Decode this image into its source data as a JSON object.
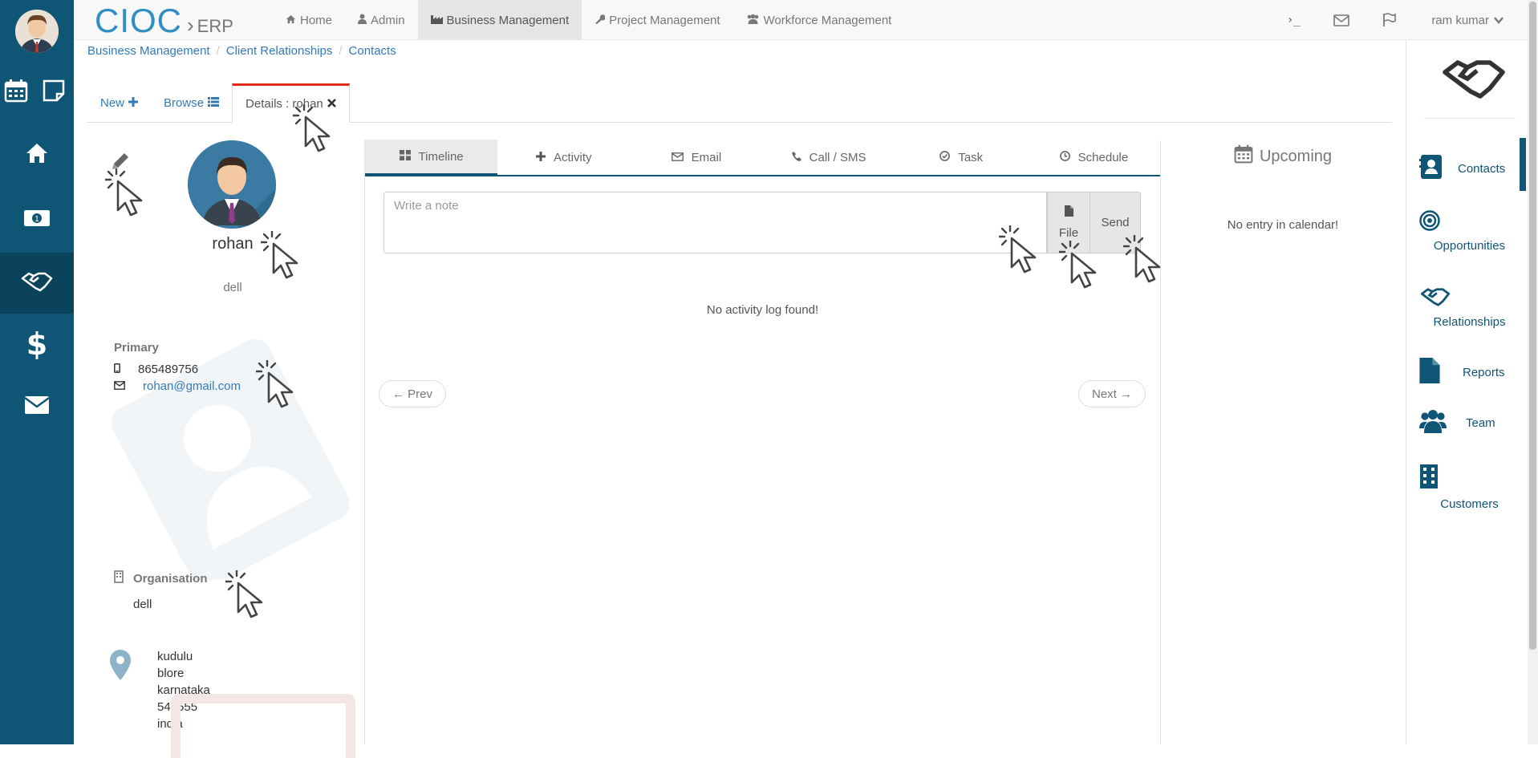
{
  "brand": {
    "logo": "CIOC",
    "separator": "›",
    "product": "ERP"
  },
  "top_menu": [
    {
      "label": "Home",
      "icon": "home-icon"
    },
    {
      "label": "Admin",
      "icon": "user-icon"
    },
    {
      "label": "Business Management",
      "icon": "industry-icon",
      "active": true
    },
    {
      "label": "Project Management",
      "icon": "wrench-icon"
    },
    {
      "label": "Workforce Management",
      "icon": "users-icon"
    }
  ],
  "top_right": {
    "terminal": "›_",
    "user_name": "ram kumar"
  },
  "breadcrumb": [
    "Business Management",
    "Client Relationships",
    "Contacts"
  ],
  "tabs": {
    "new": "New",
    "browse": "Browse",
    "details": "Details : rohan"
  },
  "contact": {
    "name": "rohan",
    "company": "dell",
    "primary_label": "Primary",
    "phone": "865489756",
    "email": "rohan@gmail.com",
    "organisation_label": "Organisation",
    "organisation": "dell",
    "address": [
      "kudulu",
      "blore",
      "karnataka",
      "543555",
      "india"
    ]
  },
  "activity_tabs": [
    "Timeline",
    "Activity",
    "Email",
    "Call / SMS",
    "Task",
    "Schedule"
  ],
  "note": {
    "placeholder": "Write a note",
    "file": "File",
    "send": "Send"
  },
  "activity_empty": "No activity log found!",
  "pager": {
    "prev": "← Prev",
    "next": "Next →"
  },
  "upcoming": {
    "title": "Upcoming",
    "empty": "No entry in calendar!"
  },
  "right_nav": [
    "Contacts",
    "Opportunities",
    "Relationships",
    "Reports",
    "Team",
    "Customers"
  ],
  "colors": {
    "primary": "#0f5575",
    "link": "#337ab7",
    "active_tab_accent": "#e0291a"
  }
}
